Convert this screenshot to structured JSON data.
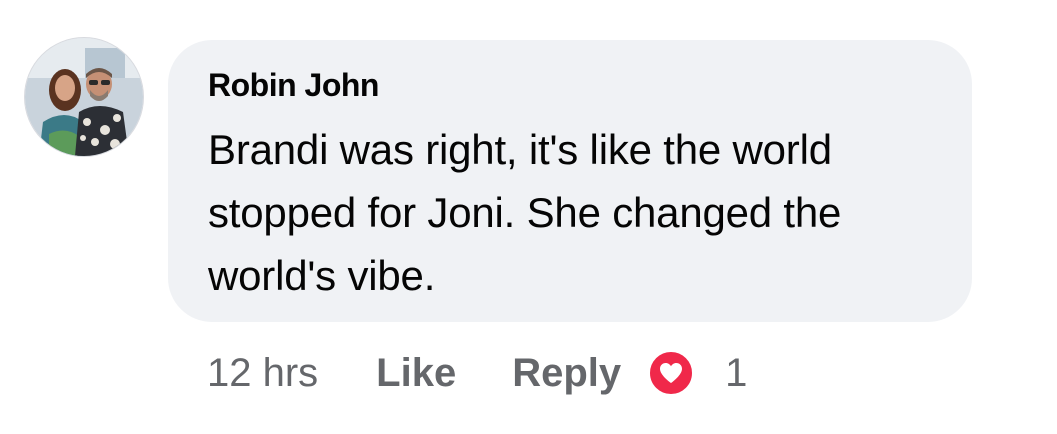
{
  "comment": {
    "author": "Robin John",
    "text": "Brandi was right, it's like the world stopped for Joni. She changed the world's vibe.",
    "timestamp": "12 hrs",
    "like_label": "Like",
    "reply_label": "Reply",
    "reaction": {
      "icon": "heart-icon",
      "color": "#f0284a",
      "count": "1"
    }
  },
  "colors": {
    "bubble_background": "#f0f2f5",
    "text_primary": "#050505",
    "text_secondary": "#65676b"
  }
}
